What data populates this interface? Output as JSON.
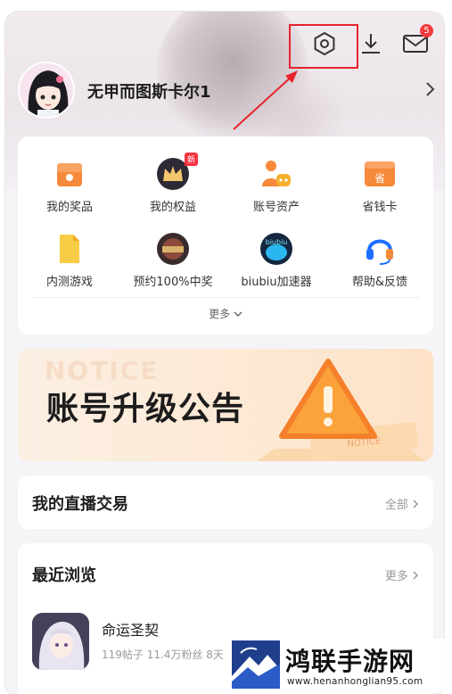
{
  "header": {
    "mail_badge": "5"
  },
  "profile": {
    "username": "无甲而图斯卡尔1"
  },
  "grid": {
    "items": [
      {
        "label": "我的奖品",
        "icon": "prize-icon"
      },
      {
        "label": "我的权益",
        "icon": "crown-icon",
        "tag": "新"
      },
      {
        "label": "账号资产",
        "icon": "account-assets-icon"
      },
      {
        "label": "省钱卡",
        "icon": "saving-card-icon",
        "icon_text": "省"
      },
      {
        "label": "内测游戏",
        "icon": "beta-game-icon"
      },
      {
        "label": "预约100%中奖",
        "icon": "reservation-game-icon"
      },
      {
        "label": "biubiu加速器",
        "icon": "biubiu-icon",
        "icon_text": "biubiu"
      },
      {
        "label": "帮助&反馈",
        "icon": "headset-icon"
      }
    ],
    "more_label": "更多"
  },
  "banner": {
    "ghost_text": "NOTICE",
    "title": "账号升级公告",
    "art_text": "NOTICE"
  },
  "live": {
    "title": "我的直播交易",
    "link": "全部"
  },
  "recent": {
    "title": "最近浏览",
    "link": "更多",
    "games": [
      {
        "name": "命运圣契",
        "stats": "119帖子   11.4万粉丝   8天"
      }
    ]
  },
  "watermark": {
    "title": "鸿联手游网",
    "url": "www.henanhonglian95.com"
  },
  "colors": {
    "accent": "#f5333f",
    "annotation": "#e8232b",
    "orange": "#f7893a",
    "background": "#f5f4f7"
  }
}
